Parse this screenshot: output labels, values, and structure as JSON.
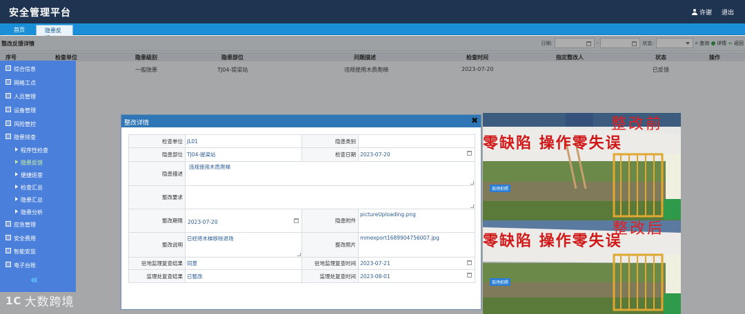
{
  "app": {
    "title": "安全管理平台",
    "user": "许谢",
    "logout": "退出"
  },
  "tabs": [
    {
      "label": "首页"
    },
    {
      "label": "隐患反馈"
    }
  ],
  "page": {
    "title": "整改反馈详情",
    "filters": {
      "date_label": "日期:",
      "date_sep": "-",
      "status_label": "状态:",
      "search": "查询",
      "detail": "详情",
      "back": "返回"
    }
  },
  "table": {
    "headers": [
      "序号",
      "检查单位",
      "隐患级别",
      "隐患部位",
      "问题描述",
      "检查时间",
      "指定整改人",
      "状态",
      "操作"
    ],
    "rows": [
      {
        "level": "一般隐患",
        "location": "TJ04-提梁站",
        "desc": "违规使用木质爬梯",
        "time": "2023-07-20",
        "status": "已反馈"
      }
    ]
  },
  "sidebar": {
    "items": [
      {
        "label": "综合信息"
      },
      {
        "label": "网格工点"
      },
      {
        "label": "人员管理"
      },
      {
        "label": "设备管理"
      },
      {
        "label": "风险管控"
      },
      {
        "label": "隐患排查"
      }
    ],
    "subitems": [
      {
        "label": "程序性检查"
      },
      {
        "label": "隐患反馈"
      },
      {
        "label": "便捷巡查"
      },
      {
        "label": "检查汇总"
      },
      {
        "label": "隐患汇总"
      },
      {
        "label": "隐患分析"
      }
    ],
    "items2": [
      {
        "label": "应急管理"
      },
      {
        "label": "安全费用"
      },
      {
        "label": "智能安监"
      },
      {
        "label": "电子台账"
      }
    ]
  },
  "modal": {
    "title": "整改详情",
    "fields": {
      "check_unit_label": "检查单位",
      "check_unit": "JL01",
      "hazard_type_label": "隐患类别",
      "hazard_type": "",
      "hazard_location_label": "隐患部位",
      "hazard_location": "TJ04-提梁站",
      "check_date_label": "检查日期",
      "check_date": "2023-07-20",
      "hazard_desc_label": "隐患描述",
      "hazard_desc": "违规使用木质爬梯",
      "requirement_label": "整改要求",
      "requirement": "",
      "deadline_label": "整改期限",
      "deadline": "2023-07-20",
      "attachment_label": "隐患附件",
      "attachment": "pictureUploading.png",
      "explain_label": "整改说明",
      "explain": "已经将木梯移除退场",
      "photo_label": "整改照片",
      "photo": "mmexport1689904756007.jpg",
      "site_review_result_label": "驻地监理复查结果",
      "site_review_result": "同意",
      "site_review_time_label": "驻地监理复查时间",
      "site_review_time": "2023-07-21",
      "office_review_result_label": "监理处复查结果",
      "office_review_result": "已整改",
      "office_review_time_label": "监理处复查时间",
      "office_review_time": "2023-08-01"
    }
  },
  "photos": {
    "before": {
      "title": "整改前",
      "banner": "零缺陷  操作零失误",
      "tag": "现场拍照"
    },
    "after": {
      "title": "整改后",
      "banner": "零缺陷  操作零失误",
      "tag": "现场拍照"
    }
  },
  "watermark": {
    "logo": "1C",
    "text": "大数跨境"
  }
}
